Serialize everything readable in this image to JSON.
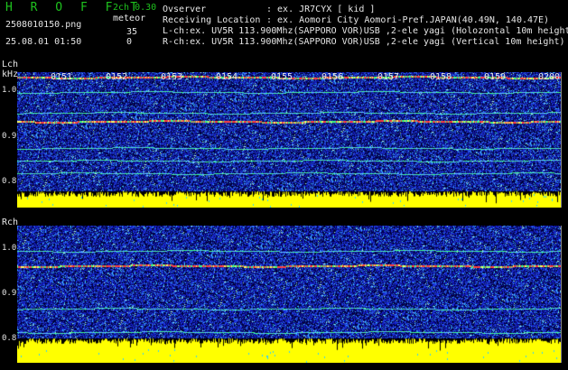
{
  "header": {
    "app_title": "H R O F F T",
    "mode": "2ch 0.30",
    "filename": "2508010150.png",
    "datetime": "25.08.01 01:50",
    "meteor_label": "meteor",
    "count_l": "35",
    "count_r": "0"
  },
  "info": {
    "observer_key": "Ovserver",
    "observer_val": ": ex. JR7CYX [ kid ]",
    "location_key": "Receiving Location",
    "location_val": ": ex. Aomori City Aomori-Pref.JAPAN(40.49N, 140.47E)",
    "lch_line": "L-ch:ex. UV5R 113.900Mhz(SAPPORO VOR)USB ,2-ele yagi (Holozontal 10m height",
    "rch_line": "R-ch:ex. UV5R 113.900Mhz(SAPPORO VOR)USB ,2-ele yagi (Vertical 10m height)"
  },
  "lch": {
    "label": "Lch",
    "unit": "kHz",
    "ticks": [
      "1.0",
      "0.9",
      "0.8"
    ],
    "times": [
      "0151",
      "0152",
      "0153",
      "0154",
      "0155",
      "0156",
      "0157",
      "0158",
      "0159",
      "0200"
    ]
  },
  "rch": {
    "label": "Rch",
    "ticks": [
      "1.0",
      "0.9",
      "0.8"
    ]
  },
  "colors": {
    "noise": "#1c2aa8",
    "signal_red": "#ff3030",
    "signal_green": "#30ff70",
    "level_yellow": "#ffff00",
    "text_green": "#1ec21e"
  }
}
